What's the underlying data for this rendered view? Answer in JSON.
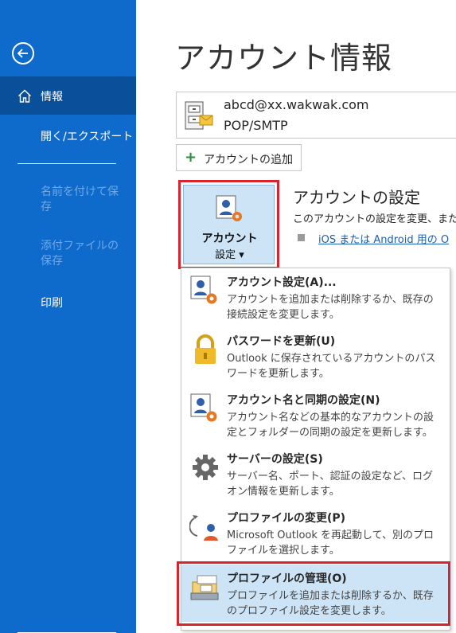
{
  "sidebar": {
    "back_icon": "back-arrow-icon",
    "items": [
      {
        "label": "情報",
        "icon": "home-icon",
        "active": true
      },
      {
        "label": "開く/エクスポート"
      },
      {
        "label": "名前を付けて保存",
        "disabled": true
      },
      {
        "label": "添付ファイルの保存",
        "disabled": true
      },
      {
        "label": "印刷"
      }
    ]
  },
  "main": {
    "title": "アカウント情報",
    "account": {
      "email": "abcd@xx.wakwak.com",
      "type": "POP/SMTP"
    },
    "add_account_label": "アカウントの追加",
    "account_settings_button": {
      "line1": "アカウント",
      "line2": "設定 ▾"
    },
    "section": {
      "title": "アカウントの設定",
      "description": "このアカウントの設定を変更、または",
      "link": "iOS または Android 用の O"
    }
  },
  "menu": {
    "items": [
      {
        "title": "アカウント設定(A)...",
        "desc": "アカウントを追加または削除するか、既存の接続設定を変更します。",
        "icon": "account-settings-icon"
      },
      {
        "title": "パスワードを更新(U)",
        "desc": "Outlook に保存されているアカウントのパスワードを更新します。",
        "icon": "lock-icon"
      },
      {
        "title": "アカウント名と同期の設定(N)",
        "desc": "アカウント名などの基本的なアカウントの設定とフォルダーの同期の設定を更新します。",
        "icon": "account-sync-icon"
      },
      {
        "title": "サーバーの設定(S)",
        "desc": "サーバー名、ポート、認証の設定など、ログオン情報を更新します。",
        "icon": "gear-icon"
      },
      {
        "title": "プロファイルの変更(P)",
        "desc": "Microsoft Outlook を再起動して、別のプロファイルを選択します。",
        "icon": "profile-change-icon"
      },
      {
        "title": "プロファイルの管理(O)",
        "desc": "プロファイルを追加または削除するか、既存のプロファイル設定を変更します。",
        "icon": "profile-manage-icon",
        "selected": true
      }
    ]
  },
  "colors": {
    "sidebar": "#0f6bcb",
    "sidebar_active": "#0a4f9a",
    "highlight": "#cde4f7",
    "callout": "#d9232d"
  }
}
